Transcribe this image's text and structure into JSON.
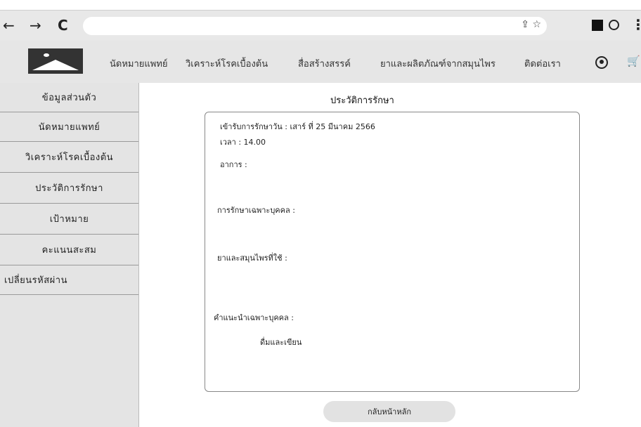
{
  "browser": {
    "back_glyph": "←",
    "forward_glyph": "→",
    "reload_glyph": "C",
    "url_icons": "⇪ ☆",
    "menu_glyph": "⋮"
  },
  "navbar": {
    "menu": [
      {
        "label": "นัดหมายแพทย์"
      },
      {
        "label": "วิเคราะห์โรคเบื้องต้น"
      },
      {
        "label": "สื่อสร้างสรรค์"
      },
      {
        "label": "ยาและผลิตภัณฑ์จากสมุนไพร"
      },
      {
        "label": "ติดต่อเรา"
      }
    ],
    "cart_glyph": "🛒"
  },
  "sidebar": {
    "items": [
      {
        "label": "ข้อมูลส่วนตัว"
      },
      {
        "label": "นัดหมายแพทย์"
      },
      {
        "label": "วิเคราะห์โรคเบื้องต้น"
      },
      {
        "label": "ประวัติการรักษา"
      },
      {
        "label": "เป้าหมาย"
      },
      {
        "label": "คะแนนสะสม"
      },
      {
        "label": "เปลี่ยนรหัสผ่าน"
      }
    ]
  },
  "main": {
    "title": "ประวัติการรักษา",
    "record": {
      "visit_date": "เข้ารับการรักษาวัน : เสาร์ ที่ 25 มีนาคม 2566",
      "time": "เวลา : 14.00",
      "symptoms_label": "อาการ :",
      "personal_treatment_label": "การรักษาเฉพาะบุคคล :",
      "medicine_label": "ยาและสมุนไพรที่ใช้ :",
      "advice_label": "คำแนะนำเฉพาะบุคคล :",
      "advice_value": "ดื่มและเขียน"
    },
    "home_button": "กลับหน้าหลัก"
  }
}
